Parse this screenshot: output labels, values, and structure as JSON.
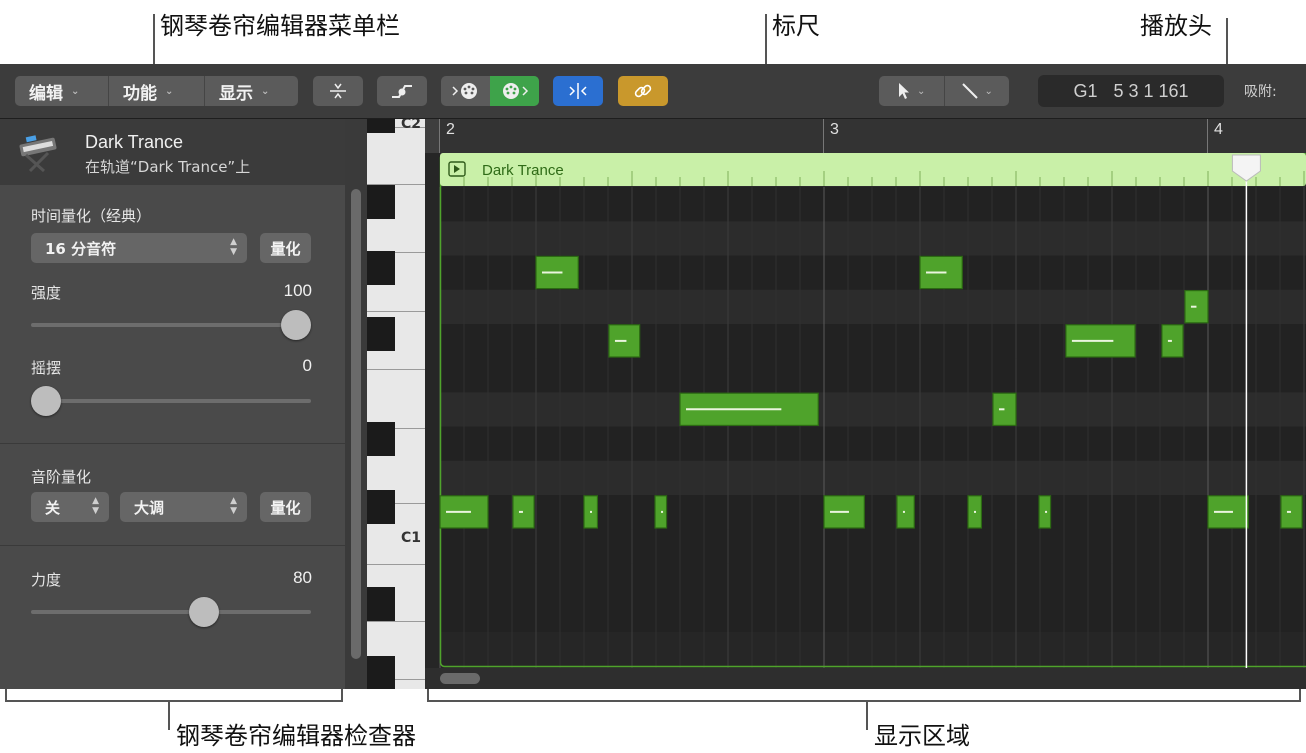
{
  "callouts": {
    "menubar": "钢琴卷帘编辑器菜单栏",
    "ruler": "标尺",
    "playhead": "播放头",
    "inspector": "钢琴卷帘编辑器检查器",
    "display": "显示区域"
  },
  "menubar": {
    "edit": "编辑",
    "functions": "功能",
    "view": "显示",
    "position_note": "G1",
    "position_value": "5 3 1 161",
    "snap_label": "吸附:"
  },
  "inspector": {
    "region_name": "Dark Trance",
    "region_sub": "在轨道“Dark Trance”上",
    "time_quantize": {
      "label": "时间量化（经典）",
      "value": "16 分音符",
      "button": "量化"
    },
    "strength": {
      "label": "强度",
      "value": "100",
      "level": 1.0
    },
    "swing": {
      "label": "摇摆",
      "value": "0",
      "level": 0.0
    },
    "scale_quantize": {
      "label": "音阶量化",
      "off_value": "关",
      "scale_value": "大调",
      "button": "量化"
    },
    "velocity": {
      "label": "力度",
      "value": "80",
      "level": 0.63
    }
  },
  "keyboard": {
    "label_top": "C2",
    "label_bottom": "C1"
  },
  "ruler": {
    "bars": [
      "2",
      "3",
      "4"
    ]
  },
  "region": {
    "name": "Dark Trance"
  },
  "colors": {
    "note": "#4fa32b",
    "note_border": "#2c6a13",
    "region_header": "#c9f0a8",
    "link_button": "#c9982c",
    "accent_blue": "#2b6fd1"
  },
  "notes": [
    {
      "bar": 2.0,
      "len": 0.125,
      "row": 9
    },
    {
      "bar": 2.19,
      "len": 0.055,
      "row": 9
    },
    {
      "bar": 2.375,
      "len": 0.035,
      "row": 9
    },
    {
      "bar": 2.56,
      "len": 0.03,
      "row": 9
    },
    {
      "bar": 3.0,
      "len": 0.105,
      "row": 9
    },
    {
      "bar": 3.19,
      "len": 0.045,
      "row": 9
    },
    {
      "bar": 3.375,
      "len": 0.035,
      "row": 9
    },
    {
      "bar": 3.56,
      "len": 0.03,
      "row": 9
    },
    {
      "bar": 4.0,
      "len": 0.105,
      "row": 9
    },
    {
      "bar": 4.19,
      "len": 0.055,
      "row": 9
    },
    {
      "bar": 2.25,
      "len": 0.11,
      "row": 2
    },
    {
      "bar": 3.25,
      "len": 0.11,
      "row": 2
    },
    {
      "bar": 2.44,
      "len": 0.08,
      "row": 4
    },
    {
      "bar": 3.63,
      "len": 0.18,
      "row": 4
    },
    {
      "bar": 3.88,
      "len": 0.055,
      "row": 4
    },
    {
      "bar": 3.94,
      "len": 0.06,
      "row": 3
    },
    {
      "bar": 2.625,
      "len": 0.36,
      "row": 6
    },
    {
      "bar": 3.44,
      "len": 0.06,
      "row": 6
    }
  ]
}
